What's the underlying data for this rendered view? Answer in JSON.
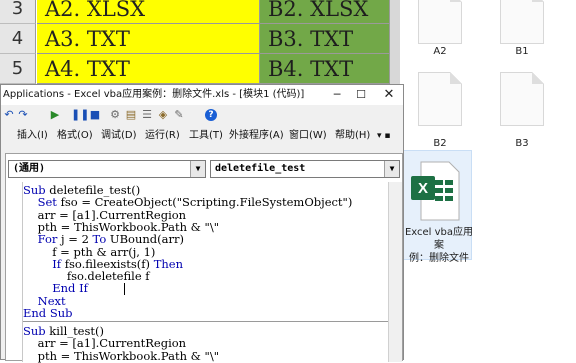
{
  "spreadsheet": {
    "rows": [
      {
        "num": "3",
        "a": "A2. XLSX",
        "b": "B2. XLSX"
      },
      {
        "num": "4",
        "a": "A3. TXT",
        "b": "B3. TXT"
      },
      {
        "num": "5",
        "a": "A4. TXT",
        "b": "B4. TXT"
      }
    ]
  },
  "explorer": {
    "files": [
      {
        "label": "A2",
        "icon": "document-icon"
      },
      {
        "label": "B1",
        "icon": "document-icon"
      },
      {
        "label": "B2",
        "icon": "document-icon"
      },
      {
        "label": "B3",
        "icon": "document-icon"
      }
    ],
    "excel_file": {
      "label_line1": "Excel vba应用案",
      "label_line2": "例：删除文件",
      "icon": "excel-file-icon"
    }
  },
  "vba_window": {
    "title": "Applications - Excel vba应用案例：删除文件.xls - [模块1 (代码)]",
    "menu": [
      "插入(I)",
      "格式(O)",
      "调试(D)",
      "运行(R)",
      "工具(T)",
      "外接程序(A)",
      "窗口(W)",
      "帮助(H)"
    ],
    "object_combo": "(通用)",
    "proc_combo": "deletefile_test",
    "code_lines": [
      "Sub deletefile_test()",
      "    Set fso = CreateObject(\"Scripting.FileSystemObject\")",
      "    arr = [a1].CurrentRegion",
      "    pth = ThisWorkbook.Path & \"\\\"",
      "    For j = 2 To UBound(arr)",
      "        f = pth & arr(j, 1)",
      "        If fso.fileexists(f) Then",
      "            fso.deletefile f",
      "        End If",
      "    Next",
      "End Sub",
      "Sub kill_test()",
      "    arr = [a1].CurrentRegion",
      "    pth = ThisWorkbook.Path & \"\\\""
    ]
  },
  "colors": {
    "cell_a": "#ffff00",
    "cell_b": "#72a848",
    "keyword": "#0000b0",
    "excel_green": "#1d7044"
  }
}
